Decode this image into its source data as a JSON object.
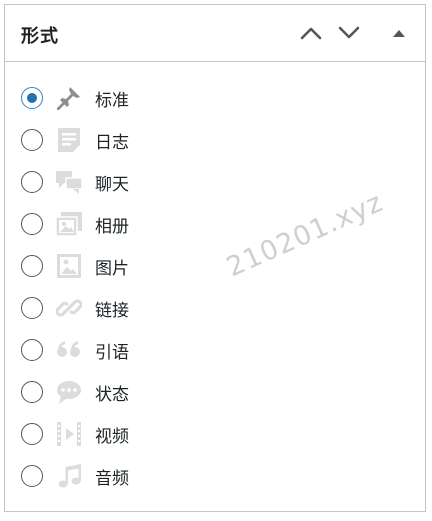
{
  "panel": {
    "title": "形式",
    "controls": {
      "move_up_icon": "chevron-up-icon",
      "move_down_icon": "chevron-down-icon",
      "toggle_icon": "triangle-up-icon"
    }
  },
  "formats": {
    "selected": "标准",
    "items": [
      {
        "label": "标准",
        "icon": "pushpin-icon",
        "checked": true
      },
      {
        "label": "日志",
        "icon": "document-icon",
        "checked": false
      },
      {
        "label": "聊天",
        "icon": "chat-icon",
        "checked": false
      },
      {
        "label": "相册",
        "icon": "gallery-icon",
        "checked": false
      },
      {
        "label": "图片",
        "icon": "image-icon",
        "checked": false
      },
      {
        "label": "链接",
        "icon": "link-icon",
        "checked": false
      },
      {
        "label": "引语",
        "icon": "quote-icon",
        "checked": false
      },
      {
        "label": "状态",
        "icon": "status-icon",
        "checked": false
      },
      {
        "label": "视频",
        "icon": "video-icon",
        "checked": false
      },
      {
        "label": "音频",
        "icon": "audio-icon",
        "checked": false
      }
    ]
  },
  "watermark": "210201.xyz",
  "colors": {
    "accent": "#2271b1",
    "icon_gray": "#dcdcde",
    "pin_gray": "#8c8f94",
    "text": "#1d2327",
    "border": "#c3c4c7"
  }
}
